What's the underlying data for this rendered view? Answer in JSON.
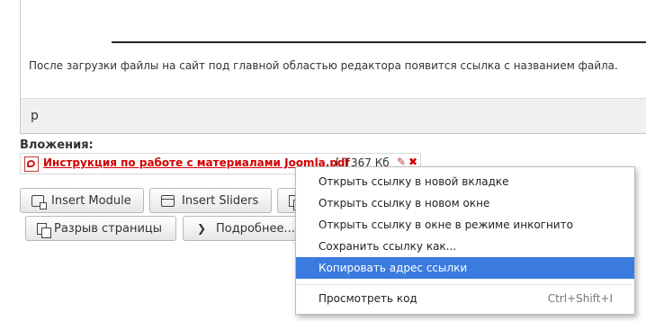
{
  "editor": {
    "paragraph": "После загрузки файлы на сайт под главной областью редактора появится ссылка с названием файла.",
    "path": "p"
  },
  "attachments": {
    "label": "Вложения:",
    "file_name": "Инструкция по работе с материалами Joomla.pdf",
    "file_size": "[ ] 367 Кб",
    "edit_icon": "pencil-icon",
    "delete_icon": "delete-icon"
  },
  "toolbar": {
    "insert_module_label": "Insert Module",
    "insert_sliders_label": "Insert Sliders",
    "page_break_label": "Разрыв страницы",
    "read_more_label": "Подробнее..."
  },
  "context_menu": {
    "items": [
      {
        "label": "Открыть ссылку в новой вкладке"
      },
      {
        "label": "Открыть ссылку в новом окне"
      },
      {
        "label": "Открыть ссылку в окне в режиме инкогнито"
      },
      {
        "label": "Сохранить ссылку как..."
      },
      {
        "label": "Копировать адрес ссылки",
        "active": true
      },
      {
        "label": "Просмотреть код",
        "shortcut": "Ctrl+Shift+I"
      }
    ],
    "highlight_color": "#3b7be0"
  }
}
